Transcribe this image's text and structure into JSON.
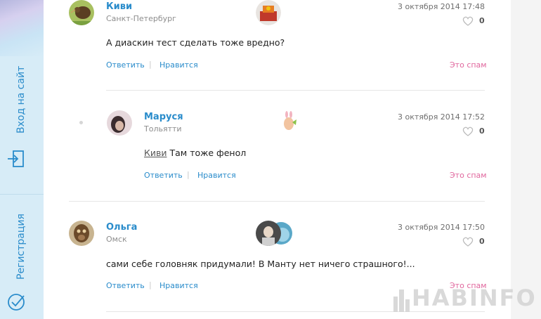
{
  "sidebar": {
    "login_label": "Вход на сайт",
    "register_label": "Регистрация",
    "login_icon": "login-arrow-icon",
    "register_icon": "check-circle-icon"
  },
  "comments": [
    {
      "name": "Киви",
      "city": "Санкт-Петербург",
      "date": "3 октября 2014 17:48",
      "likes": "0",
      "text": "А диаскин тест сделать тоже вредно?",
      "reply_label": "Ответить",
      "like_label": "Нравится",
      "spam_label": "Это спам"
    },
    {
      "name": "Маруся",
      "city": "Тольятти",
      "date": "3 октября 2014 17:52",
      "likes": "0",
      "mention": "Киви",
      "text": "Там тоже фенол",
      "reply_label": "Ответить",
      "like_label": "Нравится",
      "spam_label": "Это спам"
    },
    {
      "name": "Ольга",
      "city": "Омск",
      "date": "3 октября 2014 17:50",
      "likes": "0",
      "text": "сами себе головняк придумали! В Манту нет ничего страшного!...",
      "reply_label": "Ответить",
      "like_label": "Нравится",
      "spam_label": "Это спам"
    }
  ],
  "watermark": "HABINFO",
  "colors": {
    "link": "#2a8ccb",
    "spam": "#e0669d",
    "sidebar": "#d7ecf7"
  }
}
